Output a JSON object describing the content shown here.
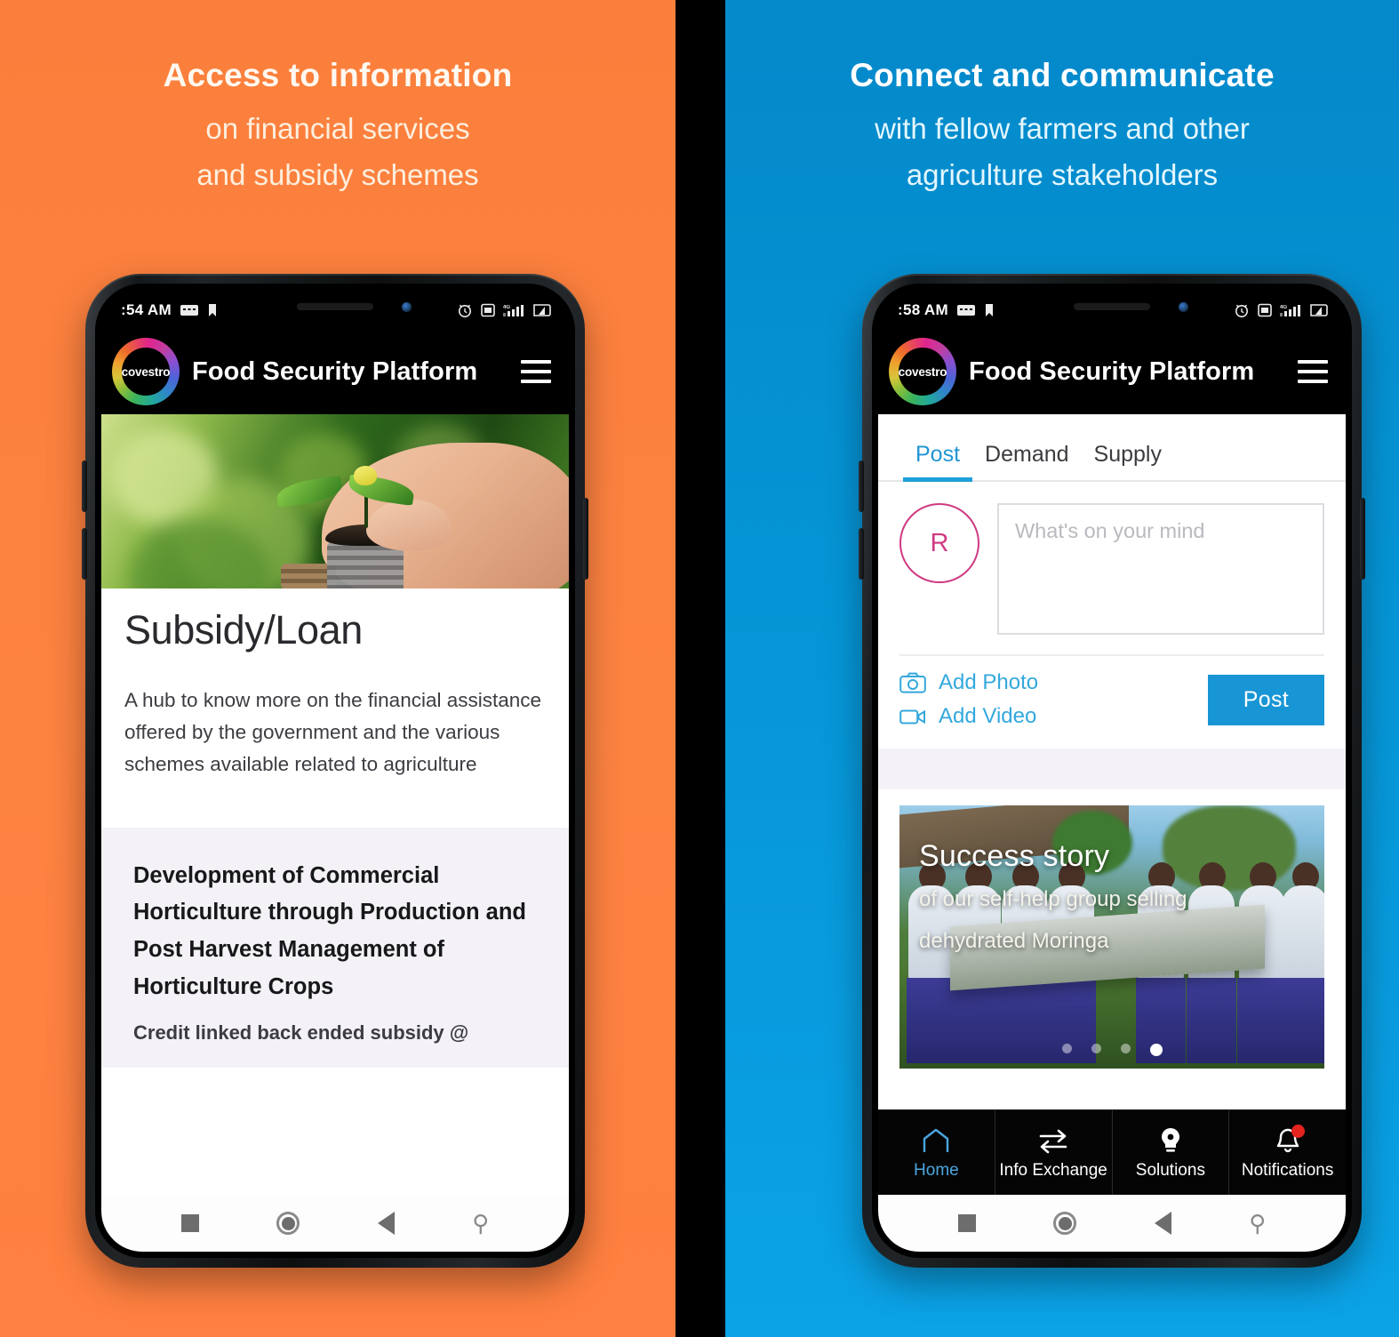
{
  "theme": {
    "orange": "#fb7f3c",
    "blue": "#0590d1",
    "accent_blue": "#1895d4",
    "avatar_pink": "#cf3a83",
    "badge_red": "#e5231f"
  },
  "left_panel": {
    "headline_main": "Access to information",
    "headline_line2": "on financial services",
    "headline_line3": "and subsidy schemes",
    "phone": {
      "status": {
        "time": ":54 AM",
        "icons": [
          "message-icon",
          "bookmark-icon",
          "alarm-icon",
          "sim-card-icon",
          "signal-4g-icon",
          "battery-icon"
        ]
      },
      "appbar": {
        "logo_text": "covestro",
        "title": "Food Security Platform",
        "menu_icon": "hamburger-menu-icon"
      },
      "hero_image_alt": "hand-holding-seedling-on-coins",
      "page_title": "Subsidy/Loan",
      "page_description": "A hub to know more on the financial assistance offered by the government and the various schemes available related to agriculture",
      "scheme_card": {
        "title": "Development of Commercial Horticulture through Production and Post Harvest Management of Horticulture Crops",
        "subtitle": "Credit linked back ended subsidy @"
      },
      "android_nav": [
        "recents-square-icon",
        "home-circle-icon",
        "back-triangle-icon",
        "accessibility-icon"
      ]
    }
  },
  "right_panel": {
    "headline_main": "Connect and communicate",
    "headline_line2": "with fellow farmers and other",
    "headline_line3": "agriculture stakeholders",
    "phone": {
      "status": {
        "time": ":58 AM",
        "icons": [
          "message-icon",
          "bookmark-icon",
          "alarm-icon",
          "sim-card-icon",
          "signal-4g-icon",
          "battery-icon"
        ]
      },
      "appbar": {
        "logo_text": "covestro",
        "title": "Food Security Platform",
        "menu_icon": "hamburger-menu-icon"
      },
      "tabs": [
        {
          "label": "Post",
          "active": true
        },
        {
          "label": "Demand",
          "active": false
        },
        {
          "label": "Supply",
          "active": false
        }
      ],
      "composer": {
        "avatar_initial": "R",
        "placeholder": "What's on your mind",
        "value": "",
        "add_photo": "Add Photo",
        "add_video": "Add Video",
        "post_button": "Post"
      },
      "story": {
        "heading": "Success story",
        "line1": "of our self-help group selling",
        "line2": "dehydrated Moringa",
        "image_alt": "self-help-group-with-drying-trays",
        "dots_total": 4,
        "dot_active_index": 4
      },
      "bottom_nav": [
        {
          "label": "Home",
          "icon": "home-icon",
          "active": true,
          "badge": false
        },
        {
          "label": "Info Exchange",
          "icon": "exchange-arrows-icon",
          "active": false,
          "badge": false
        },
        {
          "label": "Solutions",
          "icon": "lightbulb-icon",
          "active": false,
          "badge": false
        },
        {
          "label": "Notifications",
          "icon": "bell-icon",
          "active": false,
          "badge": true
        }
      ],
      "android_nav": [
        "recents-square-icon",
        "home-circle-icon",
        "back-triangle-icon",
        "accessibility-icon"
      ]
    }
  }
}
